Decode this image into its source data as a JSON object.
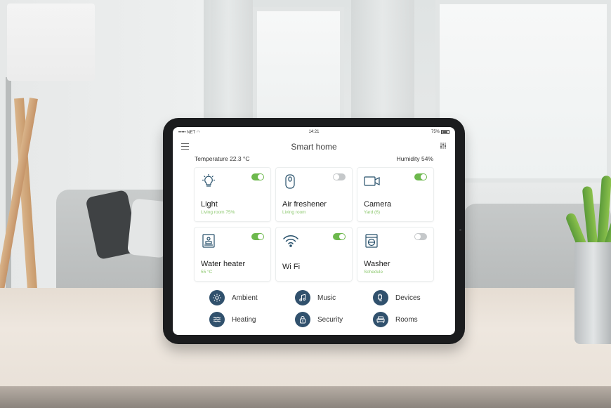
{
  "statusbar": {
    "carrier": "••••• NET ◠",
    "time": "14:21",
    "battery": "75%"
  },
  "header": {
    "title": "Smart home",
    "menu_icon": "hamburger-menu-icon",
    "filter_icon": "sliders-icon"
  },
  "readings": {
    "temperature": "Temperature 22.3 °C",
    "humidity": "Humidity 54%"
  },
  "devices": [
    {
      "name": "Light",
      "detail": "Living room 75%",
      "icon": "lightbulb-icon",
      "on": true
    },
    {
      "name": "Air freshener",
      "detail": "Living room",
      "icon": "air-freshener-icon",
      "on": false
    },
    {
      "name": "Camera",
      "detail": "Yard (6)",
      "icon": "camera-icon",
      "on": true
    },
    {
      "name": "Water heater",
      "detail": "55 °C",
      "icon": "water-heater-icon",
      "on": true
    },
    {
      "name": "Wi Fi",
      "detail": "",
      "icon": "wifi-icon",
      "on": true
    },
    {
      "name": "Washer",
      "detail": "Schedule",
      "icon": "washer-icon",
      "on": false
    }
  ],
  "quick_actions": [
    {
      "label": "Ambient",
      "icon": "sun-icon"
    },
    {
      "label": "Music",
      "icon": "music-note-icon"
    },
    {
      "label": "Devices",
      "icon": "plug-icon"
    },
    {
      "label": "Heating",
      "icon": "heat-waves-icon"
    },
    {
      "label": "Security",
      "icon": "lock-icon"
    },
    {
      "label": "Rooms",
      "icon": "sofa-icon"
    }
  ],
  "colors": {
    "accent_green": "#6db84d",
    "icon_navy": "#31516d",
    "toggle_off": "#c5c8ca"
  }
}
